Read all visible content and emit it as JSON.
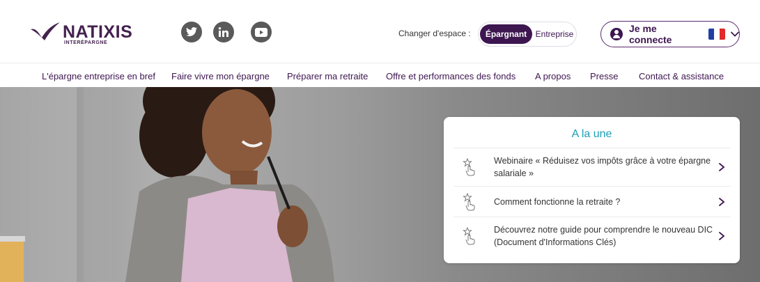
{
  "header": {
    "logo": {
      "brand": "NATIXIS",
      "subtitle": "INTERÉPARGNE"
    },
    "social": [
      {
        "name": "twitter-icon"
      },
      {
        "name": "linkedin-icon"
      },
      {
        "name": "youtube-icon"
      }
    ],
    "space_switch": {
      "label": "Changer d'espace :",
      "options": [
        "Épargnant",
        "Entreprise"
      ],
      "selected": "Épargnant"
    },
    "connect": {
      "label": "Je me connecte",
      "language": "fr"
    }
  },
  "nav": {
    "items": [
      "L'épargne entreprise en bref",
      "Faire vivre mon épargne",
      "Préparer ma retraite",
      "Offre et performances des fonds",
      "A propos",
      "Presse",
      "Contact & assistance"
    ]
  },
  "news": {
    "title": "A la une",
    "items": [
      "Webinaire « Réduisez vos impôts grâce à votre épargne salariale »",
      "Comment fonctionne la retraite ?",
      "Découvrez notre guide pour comprendre le nouveau DIC (Document d'Informations Clés)"
    ]
  },
  "colors": {
    "brand_purple": "#3d1650",
    "accent_teal": "#1b9fb6",
    "flag": [
      "#1f3fa6",
      "#ffffff",
      "#e12a2a"
    ]
  }
}
